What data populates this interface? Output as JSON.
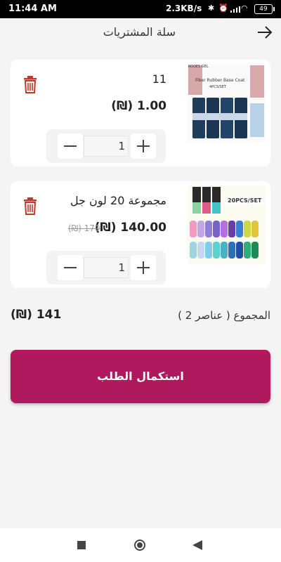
{
  "status_bar": {
    "time": "11:44 AM",
    "speed": "2.3KB/s",
    "battery": "49"
  },
  "header": {
    "title": "سلة المشتريات"
  },
  "cart": {
    "items": [
      {
        "name": "11",
        "price": "(₪) 1.00",
        "old_price": "",
        "quantity": "1",
        "image_caption": "Fiber Rubber Base Coat",
        "image_subcaption": "4PCS/SET",
        "image_brand": "KOOES GEL"
      },
      {
        "name": "مجموعة 20 لون جل",
        "price": "(₪) 140.00",
        "old_price": "(₪) 170",
        "quantity": "1",
        "image_caption": "20PCS/SET"
      }
    ],
    "total_label": "المجموع ( عناصر 2 )",
    "total_value": "(₪) 141",
    "checkout_label": "استكمال الطلب"
  },
  "colors": {
    "accent": "#b0195d",
    "trash": "#c0392b"
  }
}
